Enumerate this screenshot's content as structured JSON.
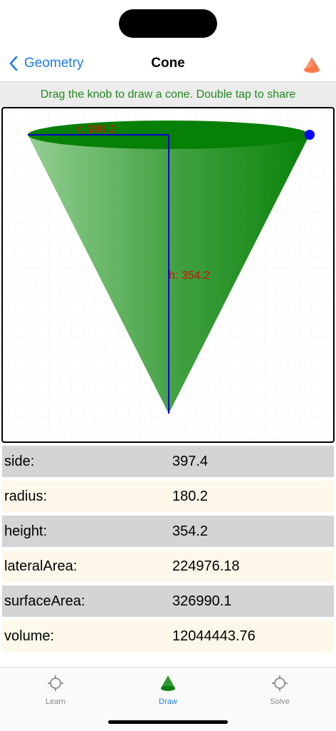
{
  "nav": {
    "back_label": "Geometry",
    "title": "Cone"
  },
  "hint": "Drag the knob to draw a cone. Double tap to share",
  "drawing": {
    "radius_label": "r: 180.2",
    "height_label": "h: 354.2",
    "fill_color": "#008000",
    "line_color": "#0000cc",
    "label_color": "#cc1100",
    "knob_color": "#0000ff"
  },
  "properties": [
    {
      "key": "side:",
      "value": "397.4"
    },
    {
      "key": "radius:",
      "value": "180.2"
    },
    {
      "key": "height:",
      "value": "354.2"
    },
    {
      "key": "lateralArea:",
      "value": "224976.18"
    },
    {
      "key": "surfaceArea:",
      "value": "326990.1"
    },
    {
      "key": "volume:",
      "value": "12044443.76"
    }
  ],
  "tabs": {
    "learn": {
      "label": "Learn",
      "icon": "crosshair-icon"
    },
    "draw": {
      "label": "Draw",
      "icon": "cone-icon"
    },
    "solve": {
      "label": "Solve",
      "icon": "crosshair-icon"
    }
  },
  "colors": {
    "accent": "#1a7cf4",
    "hint_text": "#1f8a1f",
    "row_odd": "#d4d4d4",
    "row_even": "#fdf8ea"
  }
}
